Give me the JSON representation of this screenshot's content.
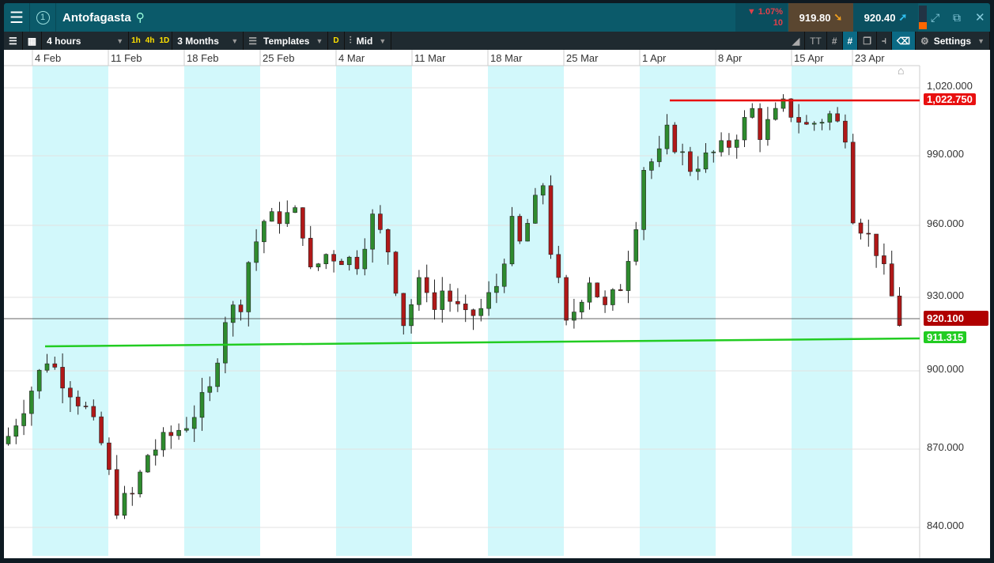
{
  "header": {
    "instrument": "Antofagasta",
    "badge": "1",
    "change_pct": "▼ 1.07%",
    "change_pts": "10",
    "bid": "919.80",
    "ask": "920.40"
  },
  "toolbar": {
    "interval": "4 hours",
    "q1": "1h",
    "q2": "4h",
    "q3": "1D",
    "range": "3 Months",
    "templates": "Templates",
    "d": "D",
    "price_type": "Mid",
    "settings": "Settings",
    "tt": "TT"
  },
  "chart_data": {
    "type": "candlestick",
    "x_ticks": [
      "4 Feb",
      "11 Feb",
      "18 Feb",
      "25 Feb",
      "4 Mar",
      "11 Mar",
      "18 Mar",
      "25 Mar",
      "1 Apr",
      "8 Apr",
      "15 Apr",
      "23 Apr"
    ],
    "y_ticks": [
      "1,020.000",
      "990.000",
      "960.000",
      "930.000",
      "900.000",
      "870.000",
      "840.000"
    ],
    "ylim": [
      835,
      1025
    ],
    "close_waypoints": [
      [
        0,
        875
      ],
      [
        3,
        893
      ],
      [
        5,
        905
      ],
      [
        7,
        897
      ],
      [
        10,
        885
      ],
      [
        12,
        872
      ],
      [
        14,
        848
      ],
      [
        16,
        852
      ],
      [
        18,
        868
      ],
      [
        23,
        880
      ],
      [
        26,
        892
      ],
      [
        28,
        922
      ],
      [
        30,
        928
      ],
      [
        31,
        945
      ],
      [
        33,
        962
      ],
      [
        37,
        965
      ],
      [
        38,
        958
      ],
      [
        39,
        940
      ],
      [
        41,
        948
      ],
      [
        45,
        945
      ],
      [
        47,
        963
      ],
      [
        49,
        950
      ],
      [
        51,
        920
      ],
      [
        53,
        935
      ],
      [
        54,
        935
      ],
      [
        55,
        925
      ],
      [
        56,
        933
      ],
      [
        59,
        921
      ],
      [
        61,
        925
      ],
      [
        63,
        935
      ],
      [
        65,
        960
      ],
      [
        66,
        952
      ],
      [
        69,
        978
      ],
      [
        70,
        950
      ],
      [
        71,
        935
      ],
      [
        72,
        918
      ],
      [
        75,
        938
      ],
      [
        77,
        925
      ],
      [
        79,
        935
      ],
      [
        80,
        948
      ],
      [
        81,
        962
      ],
      [
        82,
        985
      ],
      [
        84,
        990
      ],
      [
        85,
        1000
      ],
      [
        88,
        985
      ],
      [
        93,
        995
      ],
      [
        96,
        1010
      ],
      [
        97,
        1000
      ],
      [
        100,
        1012
      ],
      [
        103,
        1003
      ],
      [
        106,
        1008
      ],
      [
        108,
        1000
      ],
      [
        109,
        965
      ],
      [
        111,
        955
      ],
      [
        112,
        950
      ],
      [
        114,
        930
      ],
      [
        115,
        920
      ]
    ],
    "lines": [
      {
        "label": "1,022.750",
        "color": "#e81010"
      },
      {
        "label": "911.315",
        "color": "#22cc22"
      },
      {
        "label": "920.100",
        "color": "#b00000"
      }
    ]
  }
}
